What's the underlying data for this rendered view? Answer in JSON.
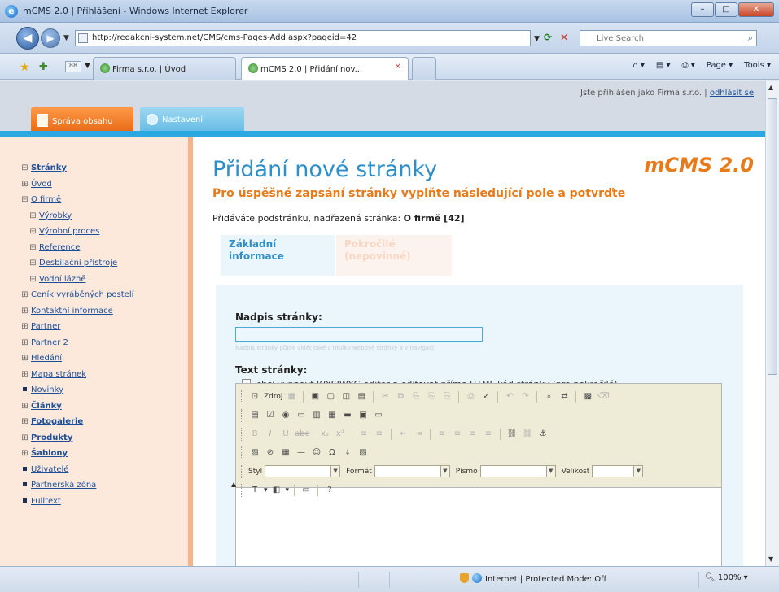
{
  "window": {
    "title": "mCMS 2.0 | Přihlášení - Windows Internet Explorer",
    "url": "http://redakcni-system.net/CMS/cms-Pages-Add.aspx?pageid=42",
    "search_placeholder": "Live Search"
  },
  "tabs": [
    {
      "label": "Firma s.r.o. | Úvod"
    },
    {
      "label": "mCMS 2.0 | Přidání nov..."
    }
  ],
  "commandbar": {
    "page": "Page ▾",
    "tools": "Tools ▾"
  },
  "header": {
    "logged_in_prefix": "Jste přihlášen jako Firma s.r.o. |",
    "logout": "odhlásit se",
    "tab_content": "Správa obsahu",
    "tab_settings": "Nastavení"
  },
  "sidebar": {
    "items": [
      {
        "label": "Stránky",
        "marker": "⊟",
        "bold": true,
        "level": 1
      },
      {
        "label": "Úvod",
        "marker": "⊞",
        "bold": false,
        "level": 2
      },
      {
        "label": "O firmě",
        "marker": "⊟",
        "bold": false,
        "level": 2
      },
      {
        "label": "Výrobky",
        "marker": "⊞",
        "bold": false,
        "level": 3
      },
      {
        "label": "Výrobní proces",
        "marker": "⊞",
        "bold": false,
        "level": 3
      },
      {
        "label": "Reference",
        "marker": "⊞",
        "bold": false,
        "level": 3
      },
      {
        "label": "Desbilační přístroje",
        "marker": "⊞",
        "bold": false,
        "level": 3
      },
      {
        "label": "Vodní lázně",
        "marker": "⊞",
        "bold": false,
        "level": 3
      },
      {
        "label": "Ceník vyráběných postelí",
        "marker": "⊞",
        "bold": false,
        "level": 2
      },
      {
        "label": "Kontaktní informace",
        "marker": "⊞",
        "bold": false,
        "level": 2
      },
      {
        "label": "Partner",
        "marker": "⊞",
        "bold": false,
        "level": 2
      },
      {
        "label": "Partner 2",
        "marker": "⊞",
        "bold": false,
        "level": 2
      },
      {
        "label": "Hledání",
        "marker": "⊞",
        "bold": false,
        "level": 2
      },
      {
        "label": "Mapa stránek",
        "marker": "⊞",
        "bold": false,
        "level": 2
      },
      {
        "label": "Novinky",
        "marker": "bullet",
        "bold": false,
        "level": 1
      },
      {
        "label": "Články",
        "marker": "⊞",
        "bold": true,
        "level": 1
      },
      {
        "label": "Fotogalerie",
        "marker": "⊞",
        "bold": true,
        "level": 1
      },
      {
        "label": "Produkty",
        "marker": "⊞",
        "bold": true,
        "level": 1
      },
      {
        "label": "Šablony",
        "marker": "⊞",
        "bold": true,
        "level": 1
      },
      {
        "label": "Uživatelé",
        "marker": "bullet",
        "bold": false,
        "level": 1
      },
      {
        "label": "Partnerská zóna",
        "marker": "bullet",
        "bold": false,
        "level": 1
      },
      {
        "label": "Fulltext",
        "marker": "bullet",
        "bold": false,
        "level": 1
      }
    ]
  },
  "main": {
    "logo": "mCMS 2.0",
    "title": "Přidání nové stránky",
    "subtitle": "Pro úspěšné zapsání stránky vyplňte následující pole a potvrďte",
    "parent_prefix": "Přidáváte podstránku, nadřazená stránka:",
    "parent_value": "O firmě [42]",
    "tab_basic": "Základní informace",
    "tab_advanced": "Pokročilé (nepovinné)",
    "field_title_label": "Nadpis stránky:",
    "field_title_value": "",
    "field_title_hint": "Nadpis stránky půjde vidět také v titulku webové stránky a v navigaci.",
    "field_text_label": "Text stránky:",
    "wysiwyg_checkbox_label": "chci vypnout WYSIWYG editor a editovat přímo HTML kód stránky (pro pokročilé)"
  },
  "editor": {
    "source_label": "Zdroj",
    "style_label": "Styl",
    "format_label": "Formát",
    "font_label": "Písmo",
    "size_label": "Velikost"
  },
  "statusbar": {
    "zone": "Internet | Protected Mode: Off",
    "zoom": "100%"
  }
}
